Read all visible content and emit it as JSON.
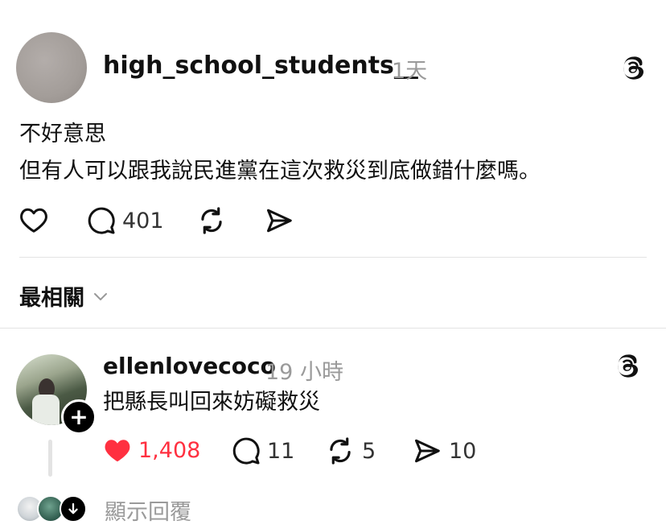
{
  "post": {
    "username": "high_school_students__",
    "time": "1天",
    "text_line1": "不好意思",
    "text_line2": "但有人可以跟我說民進黨在這次救災到底做錯什麼嗎。",
    "comment_count": "401",
    "icons": [
      "heart-icon",
      "comment-icon",
      "repost-icon",
      "share-icon",
      "threads-logo-icon"
    ]
  },
  "sort": {
    "label": "最相關",
    "icon": "chevron-down-icon"
  },
  "reply": {
    "username": "ellenlovecoco",
    "time": "19 小時",
    "text": "把縣長叫回來妨礙救災",
    "like_count": "1,408",
    "comment_count": "11",
    "repost_count": "5",
    "share_count": "10",
    "liked": true,
    "colors": {
      "liked_heart": "#ff3040",
      "like_count": "#ff3040"
    },
    "show_replies_label": "顯示回覆"
  }
}
